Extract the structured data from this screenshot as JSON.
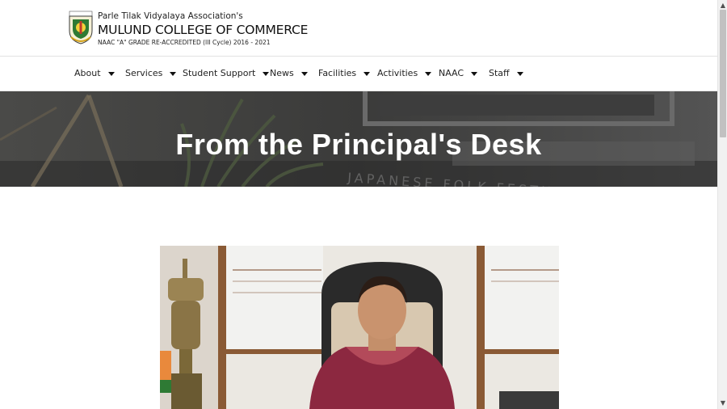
{
  "header": {
    "org_name": "Parle Tilak Vidyalaya Association's",
    "college_name": "MULUND COLLEGE OF COMMERCE",
    "accreditation": "NAAC \"A\" GRADE RE-ACCREDITED (III Cycle) 2016 - 2021",
    "logo_icon": "college-crest-icon"
  },
  "nav": {
    "items": [
      {
        "label": "About"
      },
      {
        "label": "Services"
      },
      {
        "label": "Student Support"
      },
      {
        "label": "News"
      },
      {
        "label": "Facilities"
      },
      {
        "label": "Activities"
      },
      {
        "label": "NAAC"
      },
      {
        "label": "Staff"
      }
    ],
    "dropdown_icon": "caret-down-icon"
  },
  "banner": {
    "title": "From the Principal's Desk",
    "background_text": "JAPANESE FOLK FESTIVAL"
  },
  "scrollbar": {
    "up_glyph": "▲",
    "down_glyph": "▼"
  },
  "colors": {
    "banner_overlay": "#3a3a3a",
    "text_primary": "#111111",
    "banner_text": "#ffffff"
  }
}
